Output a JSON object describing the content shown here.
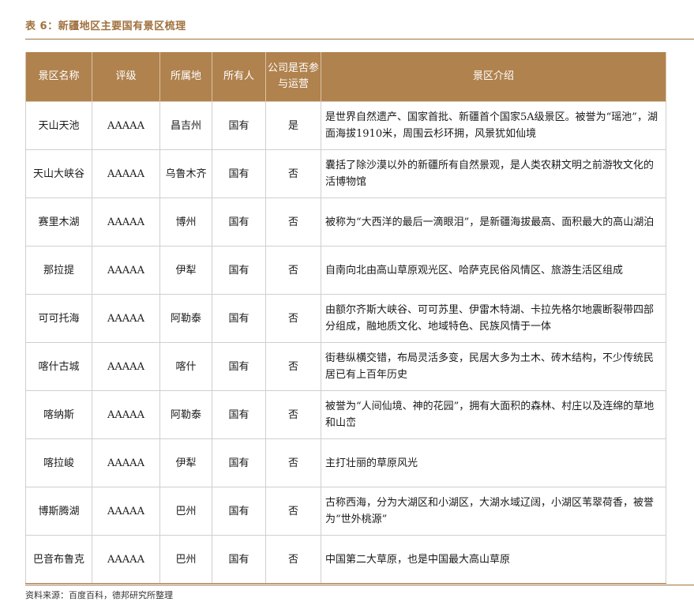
{
  "caption": "表 6：新疆地区主要国有景区梳理",
  "headers": {
    "name": "景区名称",
    "rating": "评级",
    "location": "所属地",
    "owner": "所有人",
    "operate": "公司是否参与运营",
    "intro": "景区介绍"
  },
  "rows": [
    {
      "name": "天山天池",
      "rating": "AAAAA",
      "location": "昌吉州",
      "owner": "国有",
      "operate": "是",
      "intro": "是世界自然遗产、国家首批、新疆首个国家5A级景区。被誉为“瑶池”，湖面海拔1910米，周围云杉环拥，风景犹如仙境"
    },
    {
      "name": "天山大峡谷",
      "rating": "AAAAA",
      "location": "乌鲁木齐",
      "owner": "国有",
      "operate": "否",
      "intro": "囊括了除沙漠以外的新疆所有自然景观，是人类农耕文明之前游牧文化的活博物馆"
    },
    {
      "name": "赛里木湖",
      "rating": "AAAAA",
      "location": "博州",
      "owner": "国有",
      "operate": "否",
      "intro": "被称为“大西洋的最后一滴眼泪”，是新疆海拔最高、面积最大的高山湖泊"
    },
    {
      "name": "那拉提",
      "rating": "AAAAA",
      "location": "伊犁",
      "owner": "国有",
      "operate": "否",
      "intro": "自南向北由高山草原观光区、哈萨克民俗风情区、旅游生活区组成"
    },
    {
      "name": "可可托海",
      "rating": "AAAAA",
      "location": "阿勒泰",
      "owner": "国有",
      "operate": "否",
      "intro": "由额尔齐斯大峡谷、可可苏里、伊雷木特湖、卡拉先格尔地震断裂带四部分组成，融地质文化、地域特色、民族风情于一体"
    },
    {
      "name": "喀什古城",
      "rating": "AAAAA",
      "location": "喀什",
      "owner": "国有",
      "operate": "否",
      "intro": "街巷纵横交错，布局灵活多变，民居大多为土木、砖木结构，不少传统民居已有上百年历史"
    },
    {
      "name": "喀纳斯",
      "rating": "AAAAA",
      "location": "阿勒泰",
      "owner": "国有",
      "operate": "否",
      "intro": "被誉为“人间仙境、神的花园”，拥有大面积的森林、村庄以及连绵的草地和山峦"
    },
    {
      "name": "喀拉峻",
      "rating": "AAAAA",
      "location": "伊犁",
      "owner": "国有",
      "operate": "否",
      "intro": "主打壮丽的草原风光"
    },
    {
      "name": "博斯腾湖",
      "rating": "AAAAA",
      "location": "巴州",
      "owner": "国有",
      "operate": "否",
      "intro": "古称西海，分为大湖区和小湖区，大湖水域辽阔，小湖区苇翠荷香，被誉为“世外桃源”"
    },
    {
      "name": "巴音布鲁克",
      "rating": "AAAAA",
      "location": "巴州",
      "owner": "国有",
      "operate": "否",
      "intro": "中国第二大草原，也是中国最大高山草原"
    }
  ],
  "source": "资料来源：百度百科，德邦研究所整理"
}
